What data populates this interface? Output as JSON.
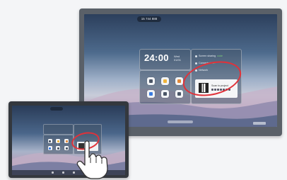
{
  "wall_display": {
    "status_pill": "15 744 888",
    "clock": {
      "time": "24:00",
      "date_line1": "Wed",
      "date_line2": "01/01"
    },
    "apps": [
      {
        "icon": "file-icon",
        "glyph_color": "#4a5566"
      },
      {
        "icon": "folder-icon",
        "glyph_color": "#f0b53a"
      },
      {
        "icon": "mail-icon",
        "glyph_color": "#e0893a"
      },
      {
        "icon": "browser-icon",
        "glyph_color": "#3a7be0"
      },
      {
        "icon": "screen-share-icon",
        "glyph_color": "#4a5566"
      },
      {
        "icon": "settings-icon",
        "glyph_color": "#4a5566"
      }
    ],
    "panel_rows": [
      {
        "label": "Screen sharing",
        "accent": "code"
      },
      {
        "label": "Connected",
        "accent": "on"
      },
      {
        "label": "Network",
        "accent": ""
      }
    ],
    "qr_card": {
      "label": "Scan to project"
    }
  },
  "tablet": {
    "apps": [
      {
        "icon": "file-icon",
        "glyph_color": "#4a5566"
      },
      {
        "icon": "folder-icon",
        "glyph_color": "#f0b53a"
      },
      {
        "icon": "mail-icon",
        "glyph_color": "#e0893a"
      },
      {
        "icon": "browser-icon",
        "glyph_color": "#3a7be0"
      },
      {
        "icon": "screen-share-icon",
        "glyph_color": "#4a5566"
      },
      {
        "icon": "settings-icon",
        "glyph_color": "#4a5566"
      }
    ]
  },
  "colors": {
    "highlight": "#e0323a",
    "bezel": "#5a6068"
  }
}
